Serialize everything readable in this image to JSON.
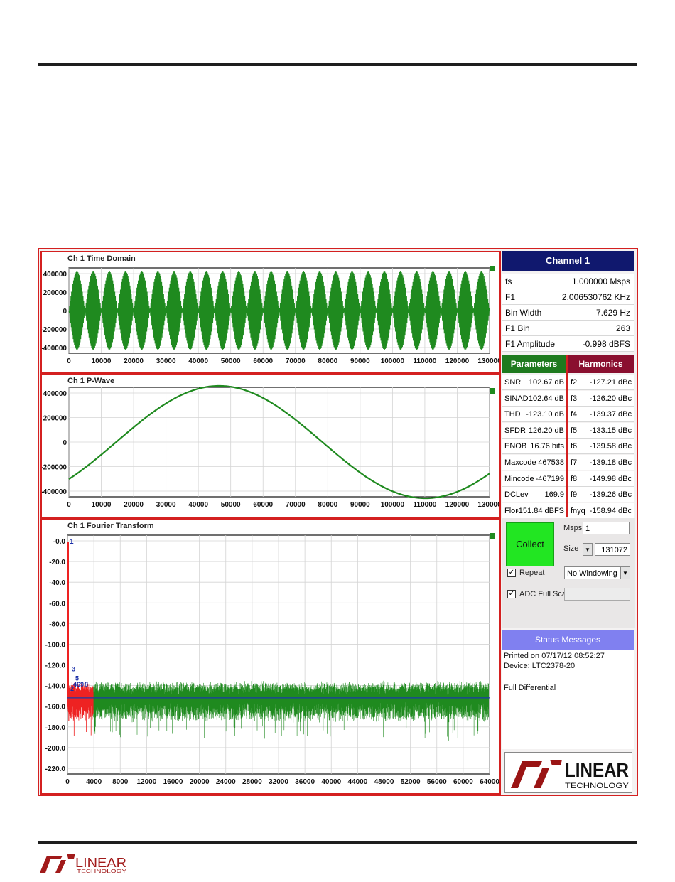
{
  "time_domain": {
    "title": "Ch 1 Time Domain",
    "y_ticks": [
      "400000",
      "200000",
      "0",
      "-200000",
      "-400000"
    ],
    "x_ticks": [
      "0",
      "10000",
      "20000",
      "30000",
      "40000",
      "50000",
      "60000",
      "70000",
      "80000",
      "90000",
      "100000",
      "110000",
      "120000",
      "130000"
    ]
  },
  "p_wave": {
    "title": "Ch 1 P-Wave",
    "y_ticks": [
      "400000",
      "200000",
      "0",
      "-200000",
      "-400000"
    ],
    "x_ticks": [
      "0",
      "10000",
      "20000",
      "30000",
      "40000",
      "50000",
      "60000",
      "70000",
      "80000",
      "90000",
      "100000",
      "110000",
      "120000",
      "130000"
    ]
  },
  "fft": {
    "title": "Ch 1 Fourier Transform",
    "y_ticks": [
      "-0.0",
      "-20.0",
      "-40.0",
      "-60.0",
      "-80.0",
      "-100.0",
      "-120.0",
      "-140.0",
      "-160.0",
      "-180.0",
      "-200.0",
      "-220.0"
    ],
    "x_ticks": [
      "0",
      "4000",
      "8000",
      "12000",
      "16000",
      "20000",
      "24000",
      "28000",
      "32000",
      "36000",
      "40000",
      "44000",
      "48000",
      "52000",
      "56000",
      "60000",
      "64000"
    ],
    "fundamental_label": "1",
    "harmonic_labels": [
      "3",
      "5",
      "4",
      "6",
      "9",
      "8",
      "2"
    ],
    "noise_floor_dbfs": -151.84
  },
  "channel": {
    "header": "Channel 1",
    "rows": [
      {
        "k": "fs",
        "v": "1.000000 Msps"
      },
      {
        "k": "F1",
        "v": "2.006530762 KHz"
      },
      {
        "k": "Bin Width",
        "v": "7.629 Hz"
      },
      {
        "k": "F1 Bin",
        "v": "263"
      },
      {
        "k": "F1 Amplitude",
        "v": "-0.998 dBFS"
      }
    ]
  },
  "tabs": {
    "parameters": "Parameters",
    "harmonics": "Harmonics"
  },
  "parameters": [
    {
      "k": "SNR",
      "v": "102.67 dB"
    },
    {
      "k": "SINAD",
      "v": "102.64 dB"
    },
    {
      "k": "THD",
      "v": "-123.10 dB"
    },
    {
      "k": "SFDR",
      "v": "126.20 dB"
    },
    {
      "k": "ENOB",
      "v": "16.76 bits"
    },
    {
      "k": "Maxcode",
      "v": "467538"
    },
    {
      "k": "Mincode",
      "v": "-467199"
    },
    {
      "k": "DCLev",
      "v": "169.9"
    },
    {
      "k": "Flor",
      "v": "-151.84 dBFS"
    }
  ],
  "harmonics": [
    {
      "k": "f2",
      "v": "-127.21 dBc"
    },
    {
      "k": "f3",
      "v": "-126.20 dBc"
    },
    {
      "k": "f4",
      "v": "-139.37 dBc"
    },
    {
      "k": "f5",
      "v": "-133.15 dBc"
    },
    {
      "k": "f6",
      "v": "-139.58 dBc"
    },
    {
      "k": "f7",
      "v": "-139.18 dBc"
    },
    {
      "k": "f8",
      "v": "-149.98 dBc"
    },
    {
      "k": "f9",
      "v": "-139.26 dBc"
    },
    {
      "k": "fnyq",
      "v": "-158.94 dBc"
    }
  ],
  "controls": {
    "collect": "Collect",
    "msps_label": "Msps",
    "msps_value": "1",
    "size_label": "Size",
    "size_value": "131072",
    "repeat_label": "Repeat",
    "repeat_checked": true,
    "windowing": "No Windowing",
    "adc_label": "ADC Full Scale",
    "adc_checked": true
  },
  "status": {
    "header": "Status Messages",
    "line1": "Printed on 07/17/12 08:52:27",
    "line2": "Device: LTC2378-20",
    "line3": "Full Differential"
  },
  "logo": {
    "word": "LINEAR",
    "sub": "TECHNOLOGY"
  },
  "colors": {
    "frame": "#d42020",
    "trace": "#1f8a1f",
    "harmonic_fill": "#ee2222",
    "channel_header": "#10186e",
    "params_tab": "#1e7a1e",
    "harmonics_tab": "#8a0f2f",
    "status_header": "#8080f0",
    "collect": "#22e622"
  }
}
